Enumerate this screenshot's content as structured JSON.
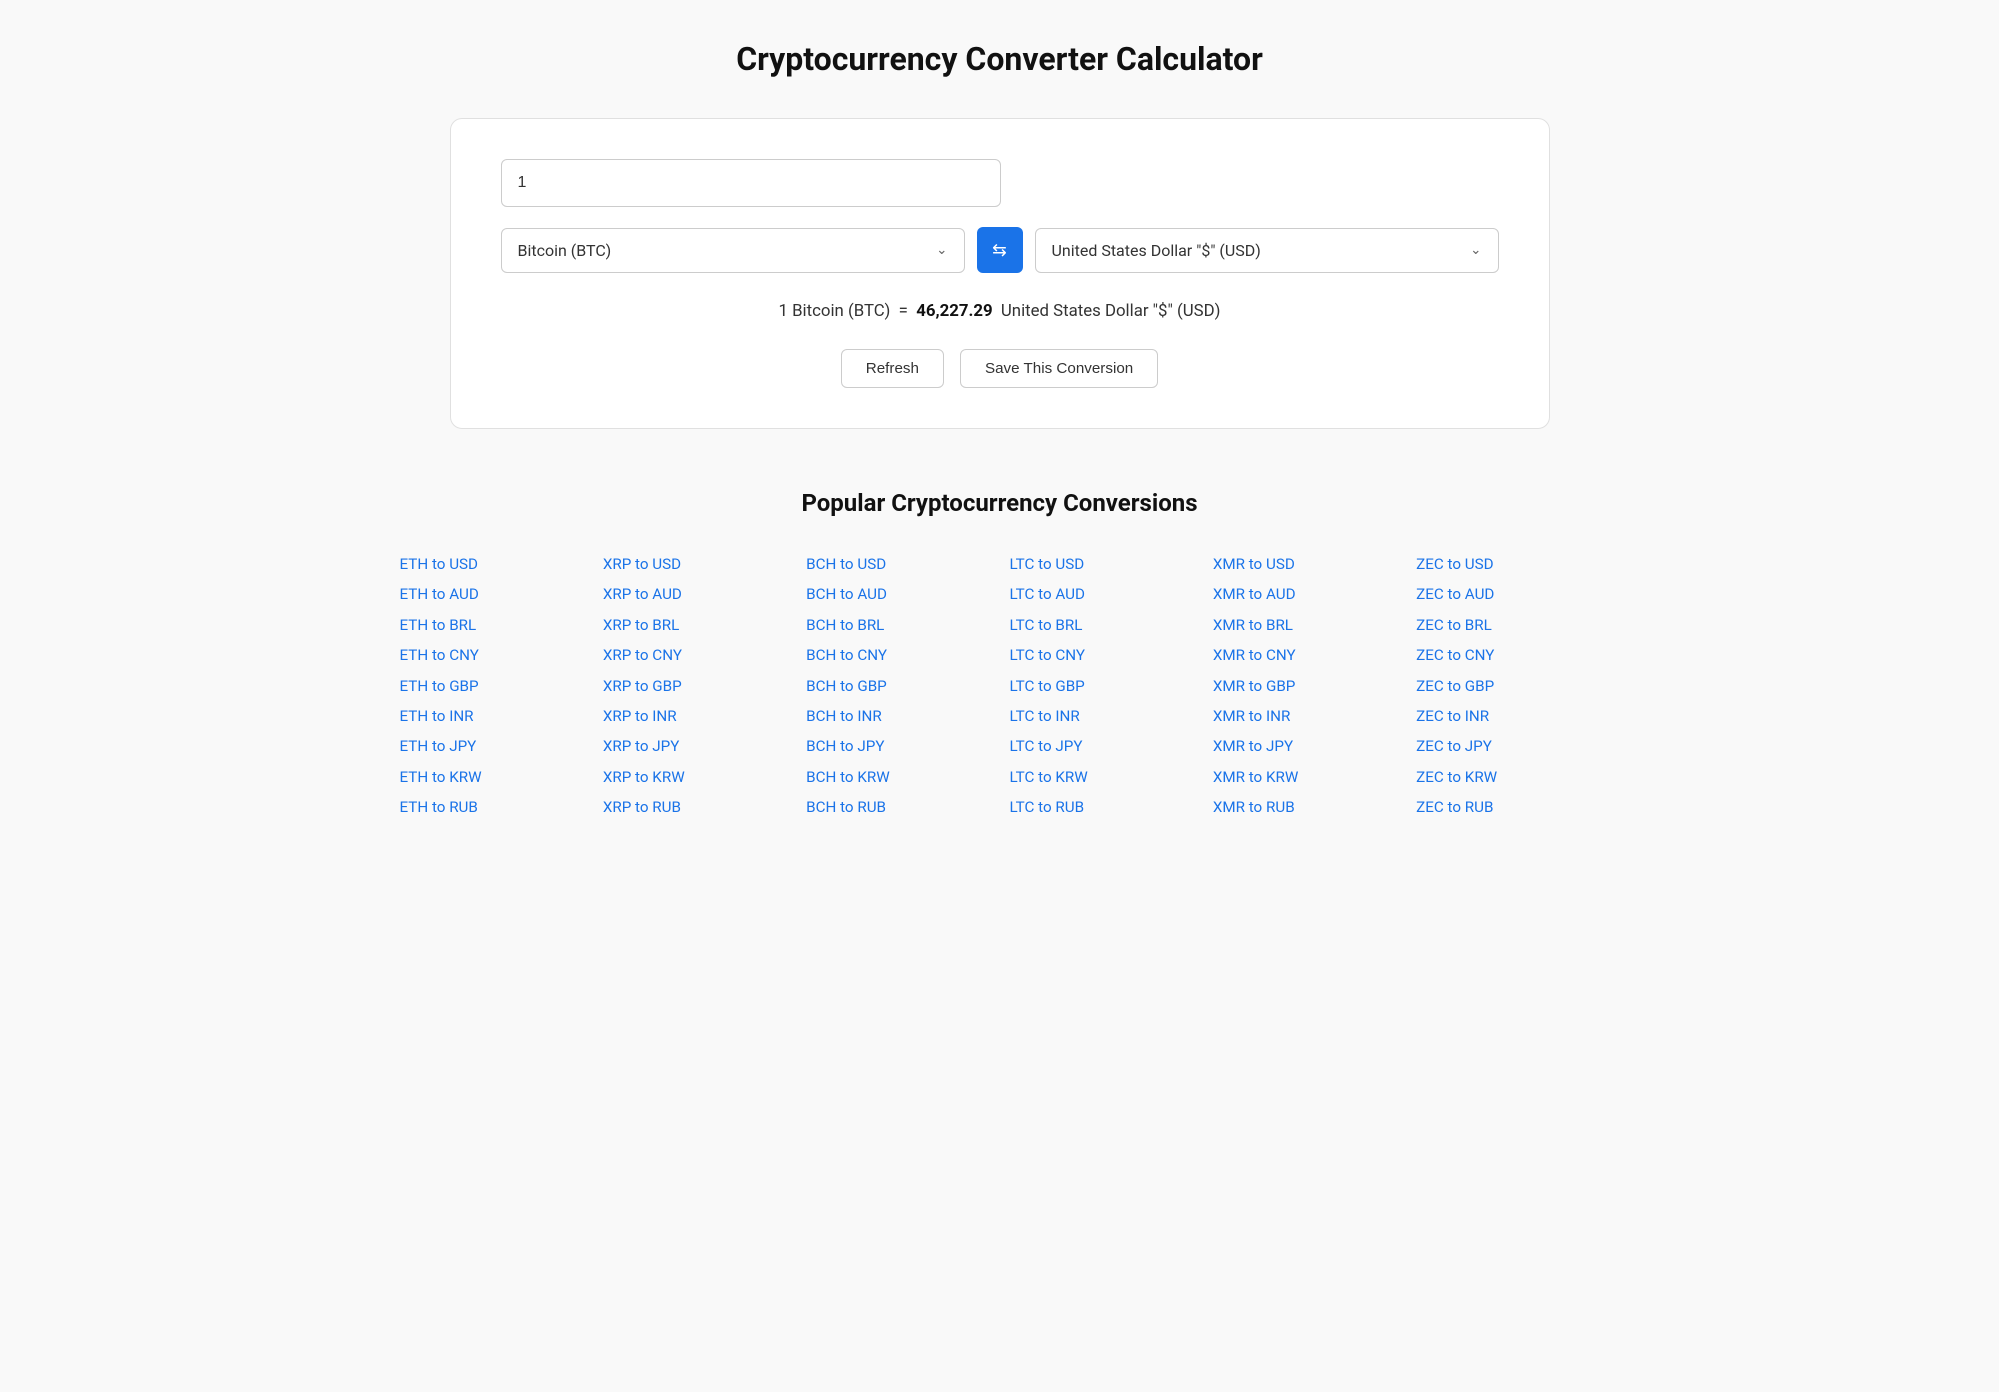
{
  "page": {
    "title": "Cryptocurrency Converter Calculator"
  },
  "converter": {
    "amount_value": "1",
    "from_currency": "Bitcoin (BTC)",
    "to_currency": "United States Dollar \"$\" (USD)",
    "result_text": "1 Bitcoin (BTC)",
    "result_equals": "=",
    "result_value": "46,227.29",
    "result_unit": "United States Dollar \"$\" (USD)",
    "refresh_label": "Refresh",
    "save_label": "Save This Conversion"
  },
  "popular": {
    "section_title": "Popular Cryptocurrency Conversions",
    "columns": [
      {
        "id": "eth",
        "links": [
          "ETH to USD",
          "ETH to AUD",
          "ETH to BRL",
          "ETH to CNY",
          "ETH to GBP",
          "ETH to INR",
          "ETH to JPY",
          "ETH to KRW",
          "ETH to RUB"
        ]
      },
      {
        "id": "xrp",
        "links": [
          "XRP to USD",
          "XRP to AUD",
          "XRP to BRL",
          "XRP to CNY",
          "XRP to GBP",
          "XRP to INR",
          "XRP to JPY",
          "XRP to KRW",
          "XRP to RUB"
        ]
      },
      {
        "id": "bch",
        "links": [
          "BCH to USD",
          "BCH to AUD",
          "BCH to BRL",
          "BCH to CNY",
          "BCH to GBP",
          "BCH to INR",
          "BCH to JPY",
          "BCH to KRW",
          "BCH to RUB"
        ]
      },
      {
        "id": "ltc",
        "links": [
          "LTC to USD",
          "LTC to AUD",
          "LTC to BRL",
          "LTC to CNY",
          "LTC to GBP",
          "LTC to INR",
          "LTC to JPY",
          "LTC to KRW",
          "LTC to RUB"
        ]
      },
      {
        "id": "xmr",
        "links": [
          "XMR to USD",
          "XMR to AUD",
          "XMR to BRL",
          "XMR to CNY",
          "XMR to GBP",
          "XMR to INR",
          "XMR to JPY",
          "XMR to KRW",
          "XMR to RUB"
        ]
      },
      {
        "id": "zec",
        "links": [
          "ZEC to USD",
          "ZEC to AUD",
          "ZEC to BRL",
          "ZEC to CNY",
          "ZEC to GBP",
          "ZEC to INR",
          "ZEC to JPY",
          "ZEC to KRW",
          "ZEC to RUB"
        ]
      }
    ]
  }
}
